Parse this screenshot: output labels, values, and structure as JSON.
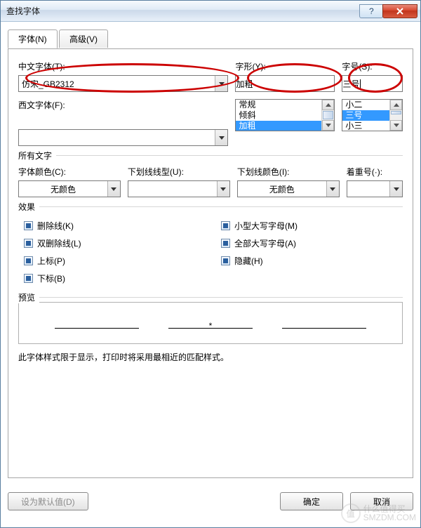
{
  "window": {
    "title": "查找字体"
  },
  "tabs": {
    "font": "字体(N)",
    "advanced": "高级(V)"
  },
  "labels": {
    "chinese_font": "中文字体(T):",
    "style": "字形(Y):",
    "size": "字号(S):",
    "western_font": "西文字体(F):",
    "all_text": "所有文字",
    "font_color": "字体颜色(C):",
    "underline_style": "下划线线型(U):",
    "underline_color": "下划线颜色(I):",
    "emphasis": "着重号(·):",
    "effects": "效果",
    "preview": "预览",
    "note": "此字体样式限于显示，打印时将采用最相近的匹配样式。"
  },
  "values": {
    "chinese_font": "仿宋_GB2312",
    "style_input": "加粗",
    "size_input": "三号",
    "western_font": "",
    "font_color": "无颜色",
    "underline_style": "",
    "underline_color": "无颜色",
    "emphasis": ""
  },
  "style_list": [
    "常规",
    "倾斜",
    "加粗"
  ],
  "size_list": [
    "小二",
    "三号",
    "小三"
  ],
  "effects_checks": {
    "strikethrough": "删除线(K)",
    "dbl_strikethrough": "双删除线(L)",
    "superscript": "上标(P)",
    "subscript": "下标(B)",
    "small_caps": "小型大写字母(M)",
    "all_caps": "全部大写字母(A)",
    "hidden": "隐藏(H)"
  },
  "preview_star": "*",
  "buttons": {
    "set_default": "设为默认值(D)",
    "ok": "确定",
    "cancel": "取消"
  },
  "watermark": {
    "brand": "值",
    "tag": "SMZDM.COM",
    "slogan": "什么值得买"
  }
}
